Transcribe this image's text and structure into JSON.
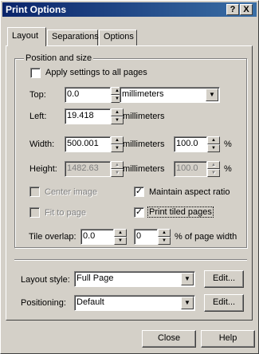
{
  "window": {
    "title": "Print Options",
    "help_btn": "?",
    "close_btn": "X"
  },
  "tabs": [
    {
      "label": "Layout",
      "active": true
    },
    {
      "label": "Separations",
      "active": false
    },
    {
      "label": "Options",
      "active": false
    }
  ],
  "position_group": {
    "label": "Position and size",
    "apply_all": {
      "label": "Apply settings to all pages",
      "checked": false
    },
    "top": {
      "label": "Top:",
      "value": "0.0",
      "unit": "millimeters"
    },
    "left": {
      "label": "Left:",
      "value": "19.418",
      "unit": "millimeters"
    },
    "width": {
      "label": "Width:",
      "value": "500.001",
      "unit": "millimeters",
      "pct": "100.0",
      "pct_sign": "%"
    },
    "height": {
      "label": "Height:",
      "value": "1482.63",
      "unit": "millimeters",
      "pct": "100.0",
      "pct_sign": "%"
    },
    "center_image": {
      "label": "Center image",
      "checked": false,
      "enabled": false
    },
    "maintain_aspect": {
      "label": "Maintain aspect ratio",
      "checked": true
    },
    "fit_to_page": {
      "label": "Fit to page",
      "checked": false,
      "enabled": false
    },
    "print_tiled": {
      "label": "Print tiled pages",
      "checked": true
    },
    "tile_overlap": {
      "label": "Tile overlap:",
      "value": "0.0",
      "pct_value": "0",
      "pct_label": "% of page width"
    }
  },
  "layout_style": {
    "label": "Layout style:",
    "value": "Full Page",
    "edit": "Edit..."
  },
  "positioning": {
    "label": "Positioning:",
    "value": "Default",
    "edit": "Edit..."
  },
  "footer": {
    "close": "Close",
    "help": "Help"
  },
  "glyphs": {
    "up": "▲",
    "down": "▼",
    "check": "✓"
  }
}
